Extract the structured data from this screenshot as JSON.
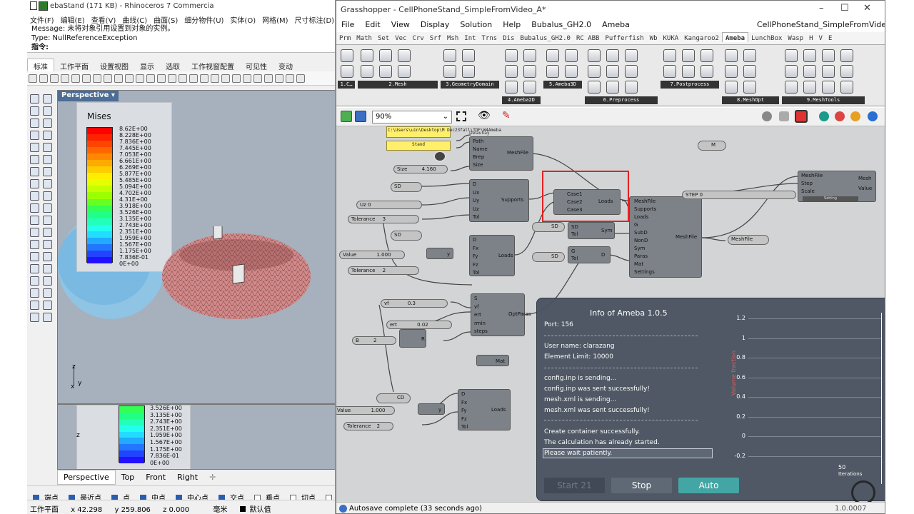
{
  "rhino": {
    "title": "ebaStand (171 KB) - Rhinoceros 7 Commercia",
    "menu": [
      "文件(F)",
      "编辑(E)",
      "查看(V)",
      "曲线(C)",
      "曲面(S)",
      "细分物件(U)",
      "实体(O)",
      "网格(M)",
      "尺寸标注(D)"
    ],
    "command": {
      "message": "Message: 未将对象引用设置到对象的实例。",
      "type": "Type: NullReferenceException",
      "prompt": "指令:"
    },
    "toolbar_tabs": [
      "标准",
      "工作平面",
      "设置视图",
      "显示",
      "选取",
      "工作视窗配置",
      "可见性",
      "变动"
    ],
    "active_tab": "标准",
    "viewport_label": "Perspective",
    "legend": {
      "title": "Mises",
      "values": [
        "8.62E+00",
        "8.228E+00",
        "7.836E+00",
        "7.445E+00",
        "7.053E+00",
        "6.661E+00",
        "6.269E+00",
        "5.877E+00",
        "5.485E+00",
        "5.094E+00",
        "4.702E+00",
        "4.31E+00",
        "3.918E+00",
        "3.526E+00",
        "3.135E+00",
        "2.743E+00",
        "2.351E+00",
        "1.959E+00",
        "1.567E+00",
        "1.175E+00",
        "7.836E-01",
        "0E+00"
      ],
      "colors": [
        "#ff0000",
        "#ff2200",
        "#ff4400",
        "#ff6600",
        "#ff8800",
        "#ffaa00",
        "#ffcc00",
        "#ffee00",
        "#e6ff00",
        "#c4ff00",
        "#9cff00",
        "#66ff22",
        "#33ff55",
        "#22ff88",
        "#22ffbb",
        "#22ffee",
        "#22ddff",
        "#22aaff",
        "#2277ff",
        "#2244ff",
        "#2211ff"
      ]
    },
    "legend2_values": [
      "3.526E+00",
      "3.135E+00",
      "2.743E+00",
      "2.351E+00",
      "1.959E+00",
      "1.567E+00",
      "1.175E+00",
      "7.836E-01",
      "0E+00"
    ],
    "axis": {
      "z": "z",
      "y": "y",
      "x": "x"
    },
    "viewport_tabs": [
      "Perspective",
      "Top",
      "Front",
      "Right"
    ],
    "osnaps": [
      {
        "label": "端点",
        "on": true
      },
      {
        "label": "最近点",
        "on": true
      },
      {
        "label": "点",
        "on": true
      },
      {
        "label": "中点",
        "on": true
      },
      {
        "label": "中心点",
        "on": true
      },
      {
        "label": "交点",
        "on": true
      },
      {
        "label": "垂点",
        "on": false
      },
      {
        "label": "切点",
        "on": false
      },
      {
        "label": "四分点",
        "on": false
      },
      {
        "label": "节点",
        "on": false
      },
      {
        "label": "顶",
        "on": false
      }
    ],
    "status": {
      "plane": "工作平面",
      "x": "x 42.298",
      "y": "y 259.806",
      "z": "z 0.000",
      "unit": "毫米",
      "layer": "默认值"
    }
  },
  "gh": {
    "title": "Grasshopper - CellPhoneStand_SimpleFromVideo_A*",
    "doc_title": "CellPhoneStand_SimpleFromVideo_A*",
    "menu": [
      "File",
      "Edit",
      "View",
      "Display",
      "Solution",
      "Help",
      "Bubalus_GH2.0",
      "Ameba"
    ],
    "tabs": [
      "Prm",
      "Math",
      "Set",
      "Vec",
      "Crv",
      "Srf",
      "Msh",
      "Int",
      "Trns",
      "Dis",
      "Bubalus_GH2.0",
      "RC ABB",
      "Pufferfish",
      "Wb",
      "KUKA",
      "Kangaroo2",
      "Ameba",
      "LunchBox",
      "Wasp",
      "H",
      "V",
      "E"
    ],
    "active_tab": "Ameba",
    "ribbon_groups": [
      "1.C…",
      "2.Mesh",
      "3.GeometryDomain",
      "4.Ameba2D",
      "5.Ameba3D",
      "6.Preprocess",
      "7.Postprocess",
      "8.MeshOpt",
      "9.MeshTools"
    ],
    "zoom": "90%",
    "canvas": {
      "path_panel": "C:\\Users\\uin\\Desktop\\M Dec23fall\\TDF\\W4Ameba",
      "stand_panel": "Stand",
      "delaunay": "Delaunay",
      "meshfile_in": [
        "Path",
        "Name",
        "Brep",
        "Size"
      ],
      "meshfile_name": "MeshFile",
      "size_label": "Size",
      "size_value": "4.160",
      "sd": "SD",
      "uz_label": "Uz",
      "uz_value": "0",
      "tol_label": "Tolerance",
      "tol_value": "3",
      "supports_in": [
        "D",
        "Ux",
        "Uy",
        "Uz",
        "Tol"
      ],
      "supports_name": "Supports",
      "cases": [
        "Case1",
        "Case2",
        "Case3"
      ],
      "loads_name": "Loads",
      "ameba_in": [
        "MeshFile",
        "Supports",
        "Loads",
        "G",
        "SubD",
        "NonD",
        "Sym",
        "Paras",
        "Mat",
        "Settings"
      ],
      "ameba_out": "MeshFile",
      "sym_in": [
        "SD",
        "Tol"
      ],
      "sym_name": "Sym",
      "d_in": [
        "G",
        "Tol"
      ],
      "d_name": "D",
      "value_label": "Value",
      "value_1": "1.000",
      "loads_in": [
        "D",
        "Fx",
        "Fy",
        "Fz",
        "Tol"
      ],
      "tol2_value": "2",
      "opt_in": [
        "S",
        "vf",
        "ert",
        "rmin",
        "steps"
      ],
      "opt_name": "OptParas",
      "vf_label": "vf",
      "vf_value": "0.3",
      "ert_label": "ert",
      "ert_value": "0.02",
      "b_label": "B",
      "b_value": "2",
      "r_label": "R",
      "mat": "Mat",
      "cd": "CD",
      "value_2": "1.000",
      "tol3_value": "2",
      "settings_in": [
        "MeshFile",
        "Step",
        "Scale"
      ],
      "settings_name": "Setting",
      "settings_out": [
        "Mesh",
        "Value"
      ],
      "step_label": "STEP",
      "step_value": "0",
      "meshfile_out": "MeshFile",
      "m_label": "M",
      "x_label": "x",
      "y_label": "y"
    },
    "info": {
      "title": "Info of Ameba 1.0.5",
      "port": "Port: 156",
      "user": "User name: clarazang",
      "limit": "Element Limit: 10000",
      "lines": [
        "config.inp is sending...",
        "config.inp was sent successfully!",
        "mesh.xml is sending...",
        "mesh.xml was sent successfully!"
      ],
      "lines2": [
        "Create container successfully.",
        "The calculation has already started.",
        "Please wait patiently."
      ],
      "buttons": {
        "start": "Start 21",
        "stop": "Stop",
        "auto": "Auto"
      },
      "plot": {
        "ylabel": "Volume fraction",
        "xlabel": "Iterations",
        "yticks": [
          "1.2",
          "1",
          "0.8",
          "0.6",
          "0.4",
          "0.2",
          "0",
          "-0.2"
        ],
        "xvalue": "50"
      }
    },
    "status": "Autosave complete (33 seconds ago)",
    "version": "1.0.0007"
  }
}
